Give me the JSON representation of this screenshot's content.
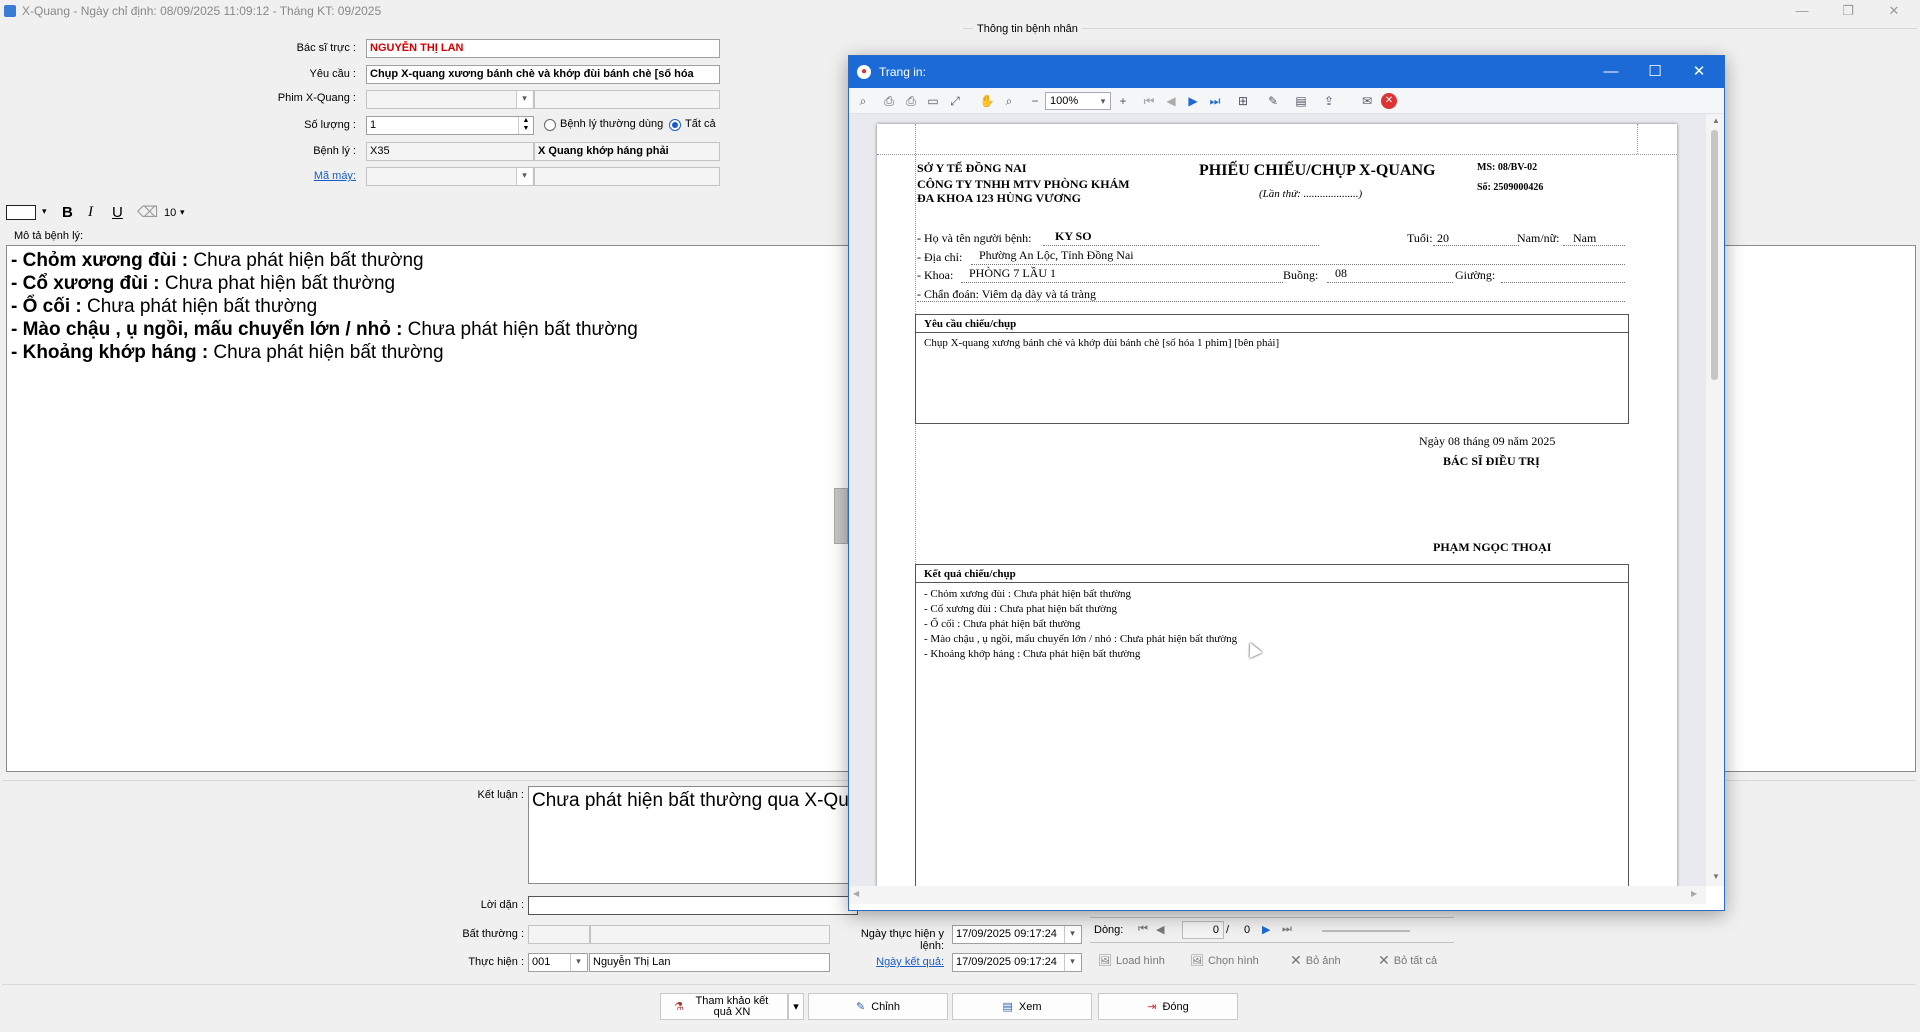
{
  "window": {
    "title": "X-Quang - Ngày chỉ định: 08/09/2025 11:09:12 - Tháng KT: 09/2025",
    "controls": {
      "minimize": "—",
      "restore": "❐",
      "close": "✕"
    }
  },
  "patient_panel": {
    "title": "Thông tin bệnh nhân"
  },
  "form": {
    "bac_si_truc": {
      "label": "Bác sĩ trực :",
      "value": "NGUYỄN THỊ LAN"
    },
    "yeu_cau": {
      "label": "Yêu cầu :",
      "value": "Chụp X-quang xương bánh chè và khớp đùi bánh chè [số hóa"
    },
    "phim": {
      "label": "Phim X-Quang :",
      "value": ""
    },
    "so_luong": {
      "label": "Số lượng :",
      "value": "1"
    },
    "radio": {
      "benh_ly_thuong_dung": "Bệnh lý thường dùng",
      "tat_ca": "Tất cả"
    },
    "benh_ly": {
      "label": "Bệnh lý :",
      "code": "X35",
      "name": "X Quang khớp háng phải"
    },
    "ma_may": {
      "label": "Mã máy:",
      "value": ""
    }
  },
  "format_bar": {
    "bold": "B",
    "italic": "I",
    "underline": "U",
    "font_size": "10"
  },
  "mo_ta": {
    "label": "Mô tả bệnh lý:",
    "lines": [
      {
        "key": "- Chỏm xương đùi :",
        "value": " Chưa phát hiện bất thường"
      },
      {
        "key": "- Cổ xương đùi :",
        "value": " Chưa phat hiện bất thường"
      },
      {
        "key": "- Ổ cối :",
        "value": " Chưa phát hiện bất thường"
      },
      {
        "key": "- Mào chậu , ụ ngồi, mấu chuyển lớn / nhỏ :",
        "value": " Chưa phát hiện bất thường"
      },
      {
        "key": "- Khoảng khớp háng :",
        "value": " Chưa phát hiện bất thường"
      }
    ]
  },
  "ket_luan": {
    "label": "Kết luận :",
    "value": "Chưa phát hiện bất thường qua X-Qu"
  },
  "loi_dan": {
    "label": "Lời dặn :",
    "value": ""
  },
  "bat_thuong": {
    "label": "Bất thường :",
    "value": ""
  },
  "thuc_hien": {
    "label": "Thực hiện :",
    "code": "001",
    "name": "Nguyễn Thị Lan"
  },
  "ngay_thuc_hien": {
    "label": "Ngày thực hiện y lệnh:",
    "value": "17/09/2025 09:17:24"
  },
  "ngay_ket_qua": {
    "label": "Ngày kết quả:",
    "value": "17/09/2025 09:17:24"
  },
  "image_tools": {
    "dong_label": "Dòng:",
    "current": "0",
    "separator": "/",
    "total": "0",
    "load": "Load hình",
    "chon": "Chọn hình",
    "bo_anh": "Bỏ ảnh",
    "bo_tat_ca": "Bỏ tất cả"
  },
  "bottom_buttons": {
    "tham_khao": "Tham khảo kết quả XN",
    "chinh": "Chỉnh",
    "xem": "Xem",
    "dong": "Đóng"
  },
  "preview": {
    "title": "Trang in:",
    "zoom": "100%",
    "controls": {
      "minimize": "—",
      "maximize": "☐",
      "close": "✕"
    },
    "report": {
      "org1": "SỞ Y TẾ ĐỒNG NAI",
      "org2": "CÔNG TY TNHH MTV PHÒNG KHÁM",
      "org3": "ĐA KHOA 123 HÙNG VƯƠNG",
      "title": "PHIẾU CHIẾU/CHỤP X-QUANG",
      "lan_thu": "(Lần thứ: ....................)",
      "ms": "MS:  08/BV-02",
      "so": "Số: 2509000426",
      "ho_ten_label": "- Họ và tên người bệnh:",
      "ho_ten": "KY SO",
      "tuoi_label": "Tuổi:",
      "tuoi": "20",
      "gioi_label": "Nam/nữ:",
      "gioi": "Nam",
      "dia_chi_label": "- Địa chỉ:",
      "dia_chi": "Phường An Lộc, Tỉnh Đồng Nai",
      "khoa_label": "- Khoa:",
      "khoa": "PHÒNG 7 LẦU 1",
      "buong_label": "Buồng:",
      "buong": "08",
      "giuong_label": "Giường:",
      "chan_doan": "- Chẩn đoán: Viêm dạ dày và tá tràng",
      "yeu_cau_header": "Yêu cầu chiếu/chụp",
      "yeu_cau_text": "Chụp X-quang xương bánh chè và khớp đùi bánh chè [số hóa 1 phim] [bên phải]",
      "ngay": "Ngày 08 tháng 09 năm 2025",
      "bac_si_dieu_tri": "BÁC SĨ ĐIỀU TRỊ",
      "bac_si_ten": "PHẠM NGỌC THOẠI",
      "ket_qua_header": "Kết quả chiếu/chụp",
      "ket_qua_lines": [
        "- Chỏm xương đùi : Chưa phát hiện bất thường",
        "- Cổ xương đùi : Chưa phat hiện bất thường",
        "- Ổ cối : Chưa phát hiện bất thường",
        "- Mào chậu , ụ ngồi, mấu chuyển lớn / nhỏ : Chưa phát hiện bất thường",
        "- Khoảng khớp háng : Chưa phát hiện bất thường"
      ]
    }
  },
  "colors": {
    "accent": "#1c6ad6",
    "doctor_red": "#d40000",
    "link": "#1a5dc8"
  }
}
